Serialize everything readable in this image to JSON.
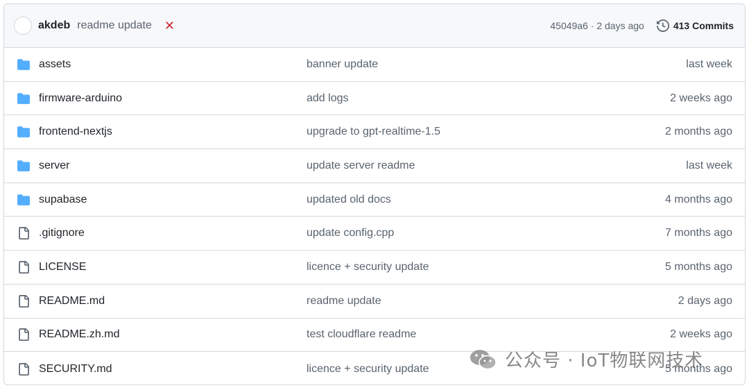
{
  "commit_bar": {
    "author": "akdeb",
    "message": "readme update",
    "status_glyph": "✕",
    "sha": "45049a6",
    "separator": " · ",
    "time": "2 days ago",
    "commits_label": "413 Commits",
    "status_color": "#d1242f"
  },
  "rows": [
    {
      "type": "folder",
      "icon": "folder-icon",
      "name": "assets",
      "message": "banner update",
      "time": "last week"
    },
    {
      "type": "folder",
      "icon": "folder-icon",
      "name": "firmware-arduino",
      "message": "add logs",
      "time": "2 weeks ago"
    },
    {
      "type": "folder",
      "icon": "folder-icon",
      "name": "frontend-nextjs",
      "message": "upgrade to gpt-realtime-1.5",
      "time": "2 months ago"
    },
    {
      "type": "folder",
      "icon": "folder-icon",
      "name": "server",
      "message": "update server readme",
      "time": "last week"
    },
    {
      "type": "folder",
      "icon": "folder-icon",
      "name": "supabase",
      "message": "updated old docs",
      "time": "4 months ago"
    },
    {
      "type": "file",
      "icon": "file-icon",
      "name": ".gitignore",
      "message": "update config.cpp",
      "time": "7 months ago"
    },
    {
      "type": "file",
      "icon": "file-icon",
      "name": "LICENSE",
      "message": "licence + security update",
      "time": "5 months ago"
    },
    {
      "type": "file",
      "icon": "file-icon",
      "name": "README.md",
      "message": "readme update",
      "time": "2 days ago"
    },
    {
      "type": "file",
      "icon": "file-icon",
      "name": "README.zh.md",
      "message": "test cloudflare readme",
      "time": "2 weeks ago"
    },
    {
      "type": "file",
      "icon": "file-icon",
      "name": "SECURITY.md",
      "message": "licence + security update",
      "time": "5 months ago"
    }
  ],
  "colors": {
    "folder": "#54aeff",
    "file": "#59636e",
    "border": "#d1d9e0",
    "header_bg": "#f6f8fa"
  },
  "watermark": {
    "text": "公众号 · IoT物联网技术",
    "icon": "wechat-icon"
  }
}
